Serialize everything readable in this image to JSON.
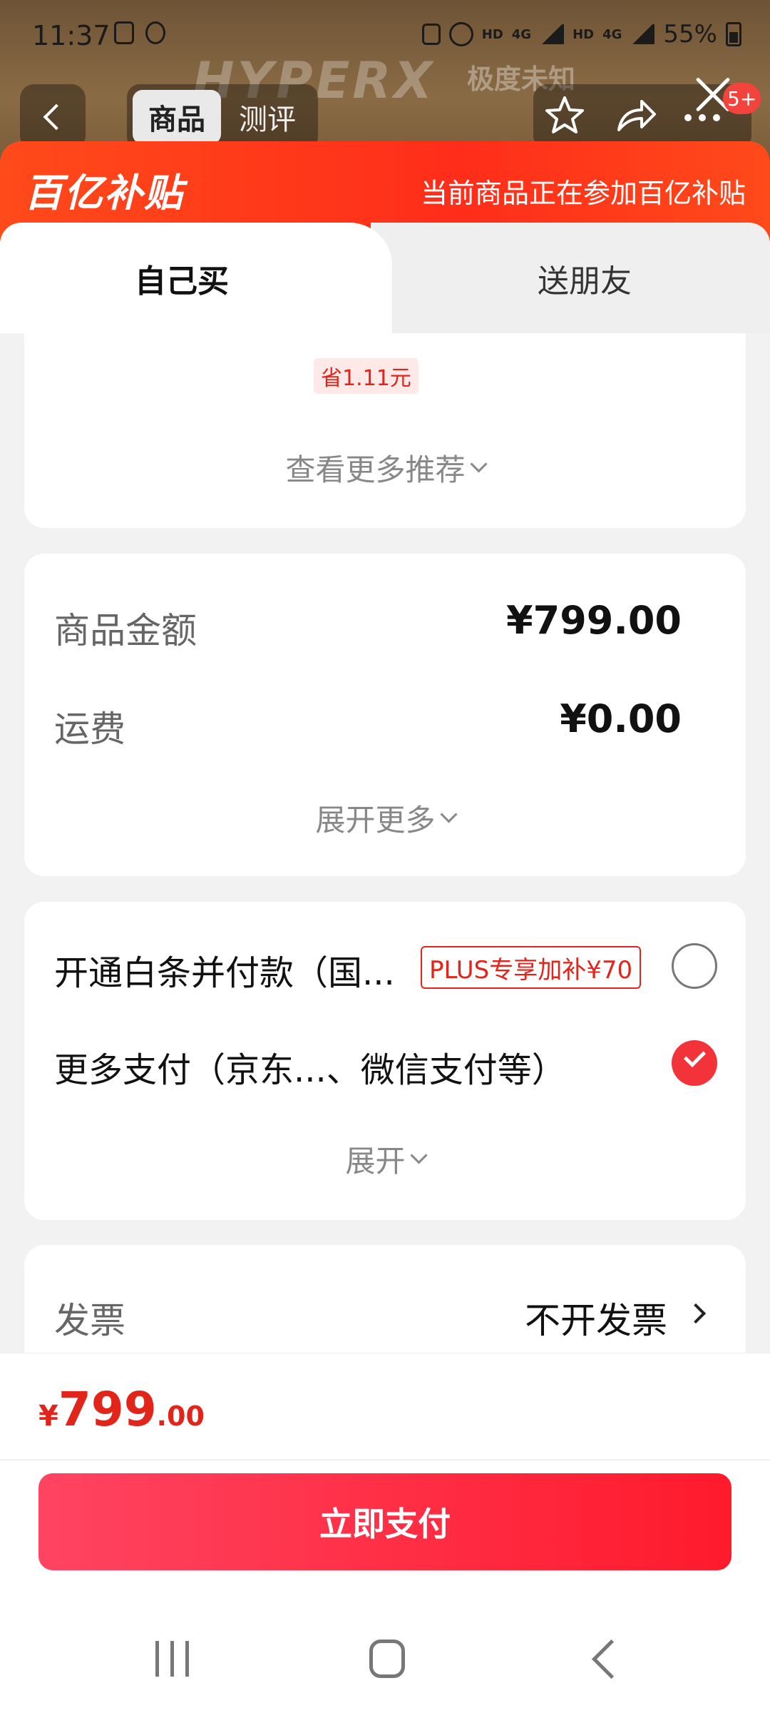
{
  "status_bar": {
    "time": "11:37",
    "network_labels": [
      "HD",
      "4G",
      "HD",
      "4G"
    ],
    "battery": "55%"
  },
  "header": {
    "brand_watermark": "HYPERX",
    "brand_sub": "极度未知",
    "tabs": [
      {
        "label": "商品",
        "active": true
      },
      {
        "label": "测评",
        "active": false
      }
    ],
    "badge_count": "5+",
    "icons": [
      "back-icon",
      "star-icon",
      "share-icon",
      "more-icon",
      "close-icon"
    ]
  },
  "subsidy": {
    "logo": "百亿补贴",
    "message": "当前商品正在参加百亿补贴"
  },
  "mode_tabs": [
    {
      "label": "自己买",
      "active": true
    },
    {
      "label": "送朋友",
      "active": false
    }
  ],
  "recommend": {
    "save_tag": "省1.11元",
    "more_label": "查看更多推荐"
  },
  "amounts": {
    "rows": [
      {
        "label": "商品金额",
        "value": "¥799.00"
      },
      {
        "label": "运费",
        "value": "¥0.00"
      }
    ],
    "expand_label": "展开更多"
  },
  "payment": {
    "options": [
      {
        "label": "开通白条并付款（国...",
        "tag": "PLUS专享加补¥70",
        "selected": false
      },
      {
        "label": "更多支付（京东...、微信支付等）",
        "selected": true
      }
    ],
    "expand_label": "展开"
  },
  "invoice": {
    "label": "发票",
    "value": "不开发票"
  },
  "checkout": {
    "currency": "¥",
    "price_int": "799",
    "price_dec": ".00",
    "pay_button": "立即支付"
  },
  "colors": {
    "accent_red": "#e1251b",
    "subsidy_orange": "#ff3b1a",
    "pay_button": "#ff2a3c"
  }
}
